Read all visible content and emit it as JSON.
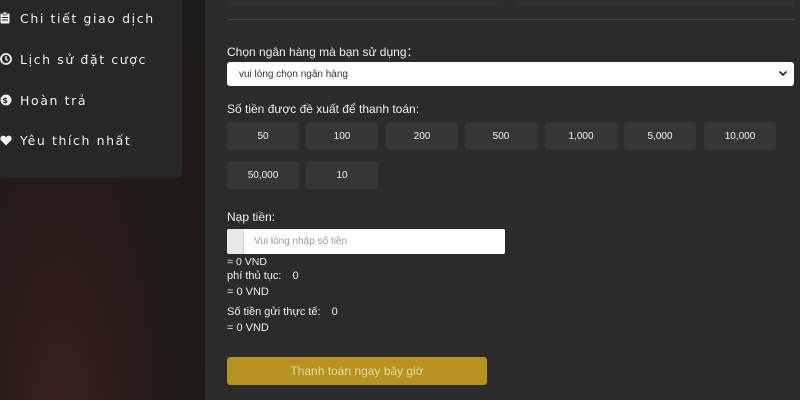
{
  "sidebar": {
    "items": [
      {
        "label": "Chi tiết giao dịch",
        "icon": "clipboard-icon"
      },
      {
        "label": "Lịch sử đặt cược",
        "icon": "clock-icon"
      },
      {
        "label": "Hoàn trả",
        "icon": "dollar-icon"
      },
      {
        "label": "Yêu thích nhất",
        "icon": "heart-icon"
      }
    ]
  },
  "form": {
    "bank_label": "Chọn ngân hàng mà bạn sử dụng：",
    "bank_selected": "vui lòng chọn ngân hàng",
    "suggest_label": "Số tiền được đề xuất để thanh toán:",
    "amounts": [
      "50",
      "100",
      "200",
      "500",
      "1,000",
      "5,000",
      "10,000",
      "50,000",
      "10"
    ],
    "deposit_label": "Nạp tiền:",
    "deposit_placeholder": "Vui lòng nhập số tiền",
    "deposit_equiv": "= 0 VND",
    "fee_label": "phí thủ tục:",
    "fee_value": "0",
    "fee_equiv": "= 0 VND",
    "actual_label": "Số tiền gửi thực tế:",
    "actual_value": "0",
    "actual_equiv": "= 0 VND",
    "pay_button": "Thanh toán ngay bây giờ"
  },
  "colors": {
    "accent": "#b8921f",
    "panel": "#2b2b2b",
    "sidebar": "#272727"
  }
}
